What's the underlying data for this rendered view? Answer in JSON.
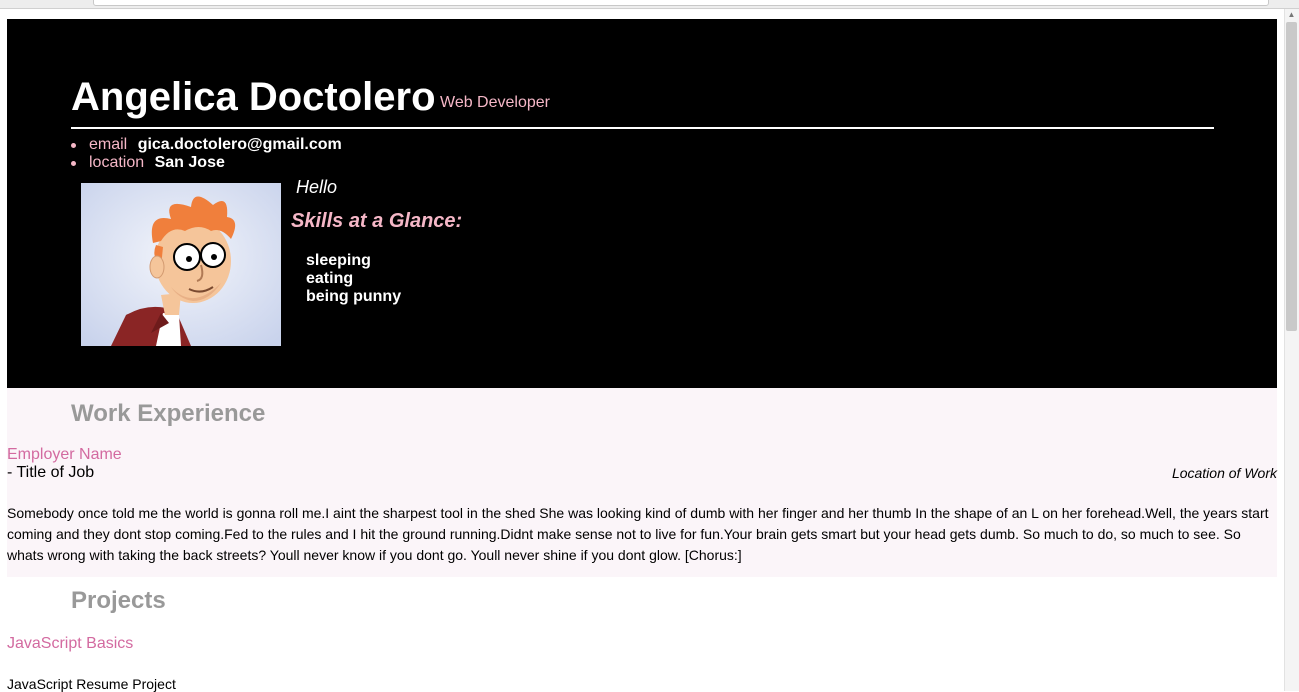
{
  "header": {
    "name": "Angelica Doctolero",
    "role": "Web Developer",
    "contacts": [
      {
        "label": "email",
        "value": "gica.doctolero@gmail.com"
      },
      {
        "label": "location",
        "value": "San Jose"
      }
    ],
    "welcome": "Hello",
    "skills_title": "Skills at a Glance:",
    "skills": [
      "sleeping",
      "eating",
      "being punny"
    ]
  },
  "work": {
    "title": "Work Experience",
    "employer": "Employer Name",
    "job_title": "- Title of Job",
    "location": "Location of Work",
    "description": "Somebody once told me the world is gonna roll me.I aint the sharpest tool in the shed She was looking kind of dumb with her finger and her thumb In the shape of an L on her forehead.Well, the years start coming and they dont stop coming.Fed to the rules and I hit the ground running.Didnt make sense not to live for fun.Your brain gets smart but your head gets dumb. So much to do, so much to see. So whats wrong with taking the back streets? Youll never know if you dont go. Youll never shine if you dont glow. [Chorus:]"
  },
  "projects": {
    "title": "Projects",
    "project_name": "JavaScript Basics",
    "project_desc": "JavaScript Resume Project"
  },
  "colors": {
    "accent_pink": "#f5b7c7",
    "link_pink": "#d36aa0",
    "header_bg": "#000000",
    "section_bg": "#fbf5f9",
    "section_title": "#999999"
  },
  "icons": {
    "avatar": "cartoon-portrait-icon",
    "scroll_up": "scroll-up-arrow-icon"
  }
}
